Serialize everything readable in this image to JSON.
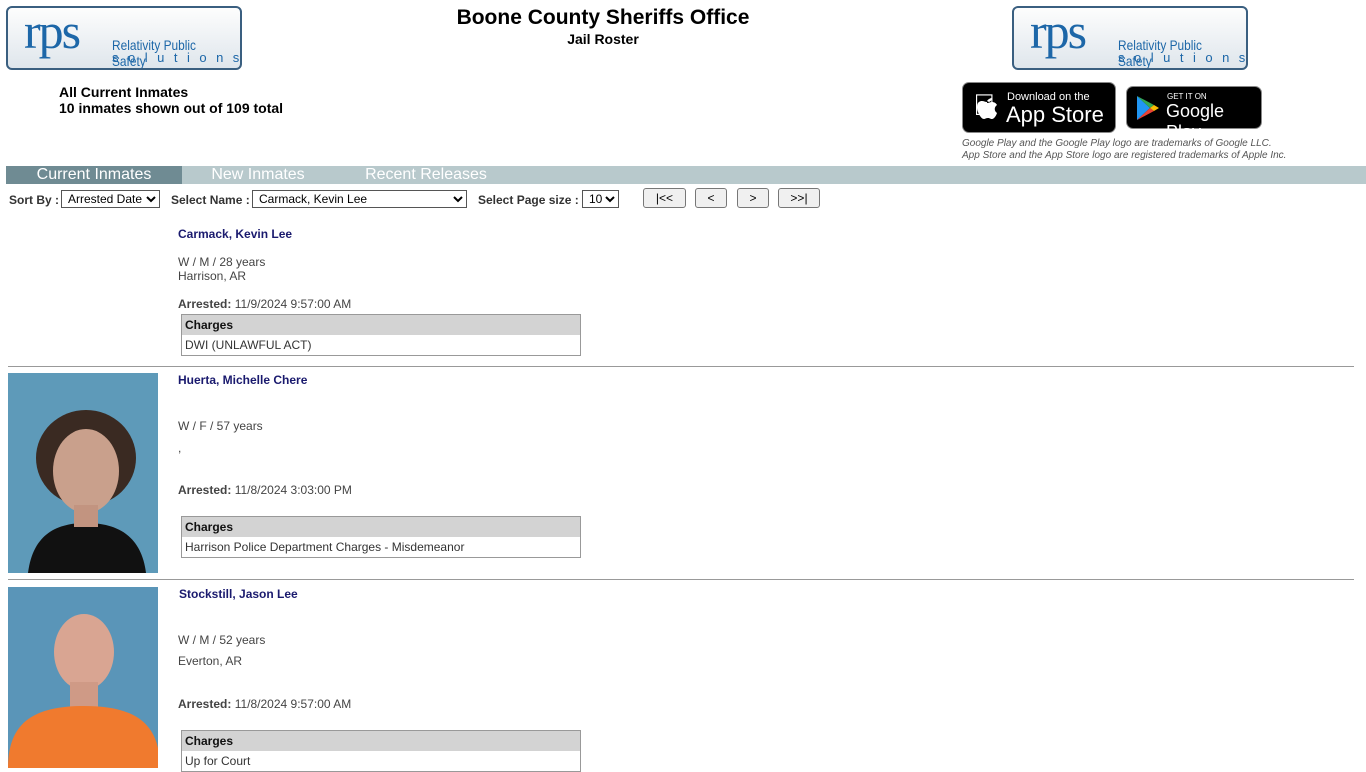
{
  "header": {
    "title": "Boone County Sheriffs Office",
    "subtitle": "Jail Roster",
    "logo_text": "rps Relativity Public Safety solutions"
  },
  "summary": {
    "line1": "All Current Inmates",
    "line2": "10 inmates shown out of 109 total"
  },
  "badges": {
    "appstore_small": "Download on the",
    "appstore_big": "App Store",
    "google_small": "GET IT ON",
    "google_big": "Google Play",
    "tm1": "Google Play and the Google Play logo are trademarks of Google LLC.",
    "tm2": "App Store and the App Store logo are registered trademarks of Apple Inc."
  },
  "tabs": [
    {
      "label": "Current Inmates",
      "active": true
    },
    {
      "label": "New Inmates"
    },
    {
      "label": "Recent Releases"
    }
  ],
  "tabs_colors": {
    "active": "#6f8b93",
    "bar": "#b8c9cc"
  },
  "controls": {
    "sort_label": "Sort By :",
    "sort_value": "Arrested Date",
    "name_label": "Select Name :",
    "name_value": "Carmack, Kevin Lee",
    "size_label": "Select Page size :",
    "size_value": "10",
    "first": "|<<",
    "prev": "<",
    "next": ">",
    "last": ">>|"
  },
  "inmates": [
    {
      "name": "Carmack, Kevin Lee",
      "demo": "W / M / 28 years",
      "city": "Harrison, AR",
      "arrested_label": "Arrested:",
      "arrested": "11/9/2024 9:57:00 AM",
      "charges_header": "Charges",
      "charges": [
        "DWI (UNLAWFUL ACT)"
      ],
      "photo": false
    },
    {
      "name": "Huerta, Michelle Chere",
      "demo": "W / F / 57 years",
      "city": ",",
      "arrested_label": "Arrested:",
      "arrested": "11/8/2024 3:03:00 PM",
      "charges_header": "Charges",
      "charges": [
        "Harrison Police Department Charges - Misdemeanor"
      ],
      "photo": true
    },
    {
      "name": "Stockstill, Jason Lee",
      "demo": "W / M / 52 years",
      "city": "Everton, AR",
      "arrested_label": "Arrested:",
      "arrested": "11/8/2024 9:57:00 AM",
      "charges_header": "Charges",
      "charges": [
        "Up for Court"
      ],
      "photo": true
    }
  ]
}
